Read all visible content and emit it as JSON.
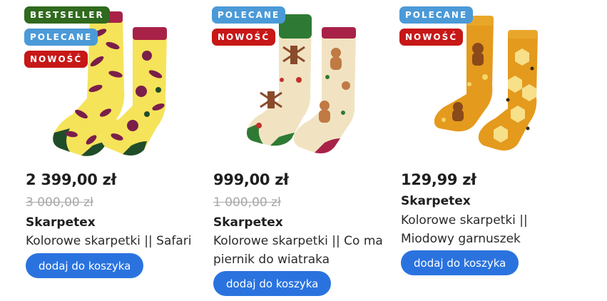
{
  "products": [
    {
      "badges": [
        "BESTSELLER",
        "POLECANE",
        "NOWOŚĆ"
      ],
      "price": "2 399,00 zł",
      "old_price": "3 000,00 zł",
      "brand": "Skarpetex",
      "name": "Kolorowe skarpetki || Safari",
      "button_label": "dodaj do koszyka",
      "image_icon": "safari-socks-image"
    },
    {
      "badges": [
        "POLECANE",
        "NOWOŚĆ"
      ],
      "price": "999,00 zł",
      "old_price": "1 000,00 zł",
      "brand": "Skarpetex",
      "name": "Kolorowe skarpetki || Co ma piernik do wiatraka",
      "button_label": "dodaj do koszyka",
      "image_icon": "gingerbread-windmill-socks-image"
    },
    {
      "badges": [
        "POLECANE",
        "NOWOŚĆ"
      ],
      "price": "129,99 zł",
      "brand": "Skarpetex",
      "name": "Kolorowe skarpetki || Miodowy garnuszek",
      "button_label": "dodaj do koszyka",
      "image_icon": "honey-pot-socks-image"
    }
  ],
  "colors": {
    "badge_bestseller": "#2f6a1e",
    "badge_polecane": "#4b9ad8",
    "badge_nowosc": "#c71717",
    "button": "#2a73df",
    "old_price": "#a7a7a7"
  }
}
